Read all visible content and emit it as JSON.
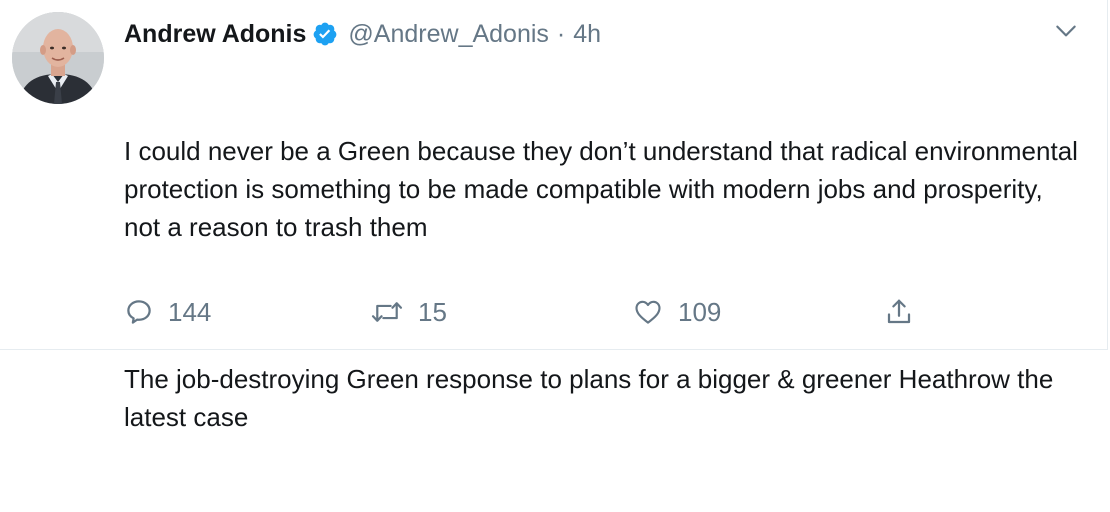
{
  "author": {
    "display_name": "Andrew Adonis",
    "handle": "@Andrew_Adonis",
    "separator": "·",
    "time": "4h",
    "verified": true
  },
  "tweet": {
    "paragraphs": [
      "I could never be a Green because they don’t understand that radical environmental protection is something to be made compatible with modern jobs and prosperity, not a reason to trash them",
      "The job-destroying Green response to plans for a bigger & greener Heathrow the latest case"
    ]
  },
  "actions": {
    "reply_count": "144",
    "retweet_count": "15",
    "like_count": "109"
  },
  "icons": {
    "reply": "speech-bubble-icon",
    "retweet": "retweet-arrows-icon",
    "like": "heart-icon",
    "share": "share-upload-icon",
    "caret": "chevron-down-icon",
    "verified": "verified-badge-icon"
  },
  "colors": {
    "text": "#14171a",
    "secondary": "#657786",
    "verified": "#1da1f2",
    "border": "#e6ecf0"
  }
}
